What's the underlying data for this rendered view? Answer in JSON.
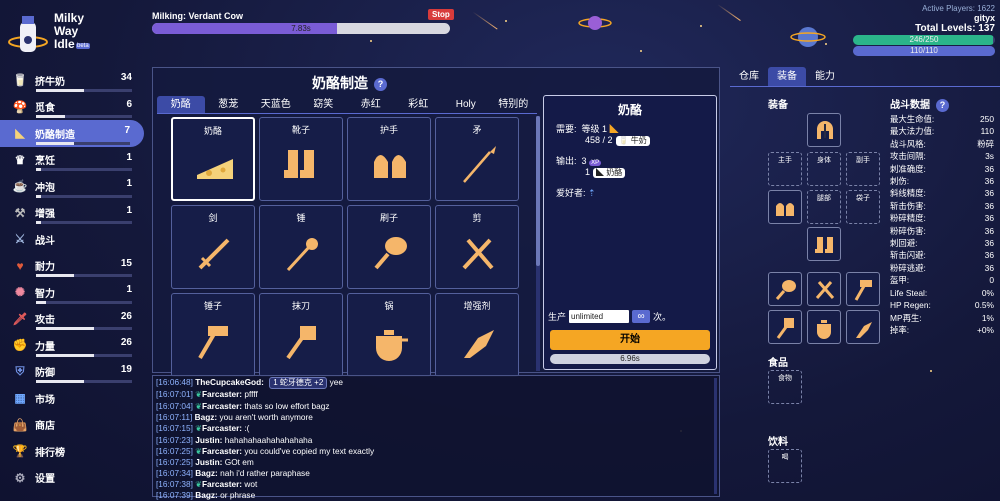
{
  "header": {
    "title_lines": [
      "Milky",
      "Way",
      "Idle"
    ],
    "beta": "beta",
    "action": "Milking: Verdant Cow",
    "stop": "Stop",
    "progress_time": "7.83s",
    "progress": 0.62,
    "active_players": "Active Players: 1622",
    "username": "gityx",
    "total_levels": "Total Levels: 137",
    "hp": "246/250",
    "hp_frac": 0.984,
    "mp": "110/110",
    "mp_frac": 1.0
  },
  "sidebar": [
    {
      "label": "挤牛奶",
      "level": "34",
      "bar": 0.5,
      "icon": "milk-icon"
    },
    {
      "label": "觅食",
      "level": "6",
      "bar": 0.3,
      "icon": "mushroom-icon"
    },
    {
      "label": "奶酪制造",
      "level": "7",
      "bar": 0.4,
      "icon": "cheese-icon",
      "active": true
    },
    {
      "label": "烹饪",
      "level": "1",
      "bar": 0.05,
      "icon": "chef-hat-icon"
    },
    {
      "label": "冲泡",
      "level": "1",
      "bar": 0.05,
      "icon": "teacup-icon"
    },
    {
      "label": "增强",
      "level": "1",
      "bar": 0.05,
      "icon": "enhance-icon"
    },
    {
      "label": "战斗",
      "level": "",
      "icon": "swords-icon"
    },
    {
      "label": "耐力",
      "level": "15",
      "bar": 0.4,
      "icon": "stamina-icon"
    },
    {
      "label": "智力",
      "level": "1",
      "bar": 0.1,
      "icon": "brain-icon"
    },
    {
      "label": "攻击",
      "level": "26",
      "bar": 0.6,
      "icon": "sword-icon"
    },
    {
      "label": "力量",
      "level": "26",
      "bar": 0.6,
      "icon": "fist-icon"
    },
    {
      "label": "防御",
      "level": "19",
      "bar": 0.5,
      "icon": "shield-icon"
    },
    {
      "label": "市场",
      "level": "",
      "icon": "market-icon"
    },
    {
      "label": "商店",
      "level": "",
      "icon": "shop-icon"
    },
    {
      "label": "排行榜",
      "level": "",
      "icon": "trophy-icon"
    },
    {
      "label": "设置",
      "level": "",
      "icon": "gear-icon"
    }
  ],
  "panel": {
    "title": "奶酪制造",
    "help": "?",
    "tabs": [
      "奶酪",
      "葱茏",
      "天蓝色",
      "窈笑",
      "赤红",
      "彩虹",
      "Holy",
      "特别的"
    ],
    "items": [
      {
        "name": "奶酪",
        "icon": "cheese-icon"
      },
      {
        "name": "靴子",
        "icon": "boots-icon"
      },
      {
        "name": "护手",
        "icon": "gloves-icon"
      },
      {
        "name": "矛",
        "icon": "spear-icon"
      },
      {
        "name": "剑",
        "icon": "sword-icon"
      },
      {
        "name": "锤",
        "icon": "mace-icon"
      },
      {
        "name": "刷子",
        "icon": "brush-icon"
      },
      {
        "name": "剪",
        "icon": "shears-icon"
      },
      {
        "name": "锤子",
        "icon": "hammer-icon"
      },
      {
        "name": "抹刀",
        "icon": "spatula-icon"
      },
      {
        "name": "锅",
        "icon": "pot-icon"
      },
      {
        "name": "增强剂",
        "icon": "enhancer-icon"
      }
    ]
  },
  "detail": {
    "title": "奶酪",
    "req_label": "需要:",
    "req_level": "等级 1",
    "req_count": "458 / 2",
    "req_item": "牛奶",
    "out_label": "输出:",
    "xp": "3",
    "xp_badge": "XP",
    "out_count": "1",
    "out_item": "奶酪",
    "fans": "爱好者:",
    "produce": "生产",
    "qty": "unlimited",
    "inf": "∞",
    "times": "次。",
    "start": "开始",
    "time": "6.96s"
  },
  "chat": [
    {
      "t": "[16:06:48]",
      "u": "TheCupcakeGod:",
      "x": "",
      "chip": "1 蛇牙德克 +2",
      "m": " yee"
    },
    {
      "t": "[16:07:01]",
      "u": "Farcaster:",
      "x": "leaf",
      "m": " pffff"
    },
    {
      "t": "[16:07:04]",
      "u": "Farcaster:",
      "x": "leaf",
      "m": " thats so low effort bagz"
    },
    {
      "t": "[16:07:11]",
      "u": "Bagz:",
      "x": "",
      "m": " you aren't worth anymore"
    },
    {
      "t": "[16:07:15]",
      "u": "Farcaster:",
      "x": "leaf",
      "m": " :("
    },
    {
      "t": "[16:07:23]",
      "u": "Justin:",
      "x": "",
      "m": " hahahahaahahahahaha"
    },
    {
      "t": "[16:07:25]",
      "u": "Farcaster:",
      "x": "leaf",
      "m": " you could've copied my text exactly"
    },
    {
      "t": "[16:07:25]",
      "u": "Justin:",
      "x": "",
      "m": " GOt em"
    },
    {
      "t": "[16:07:34]",
      "u": "Bagz:",
      "x": "",
      "m": " nah i'd rather paraphase"
    },
    {
      "t": "[16:07:38]",
      "u": "Farcaster:",
      "x": "leaf",
      "m": " wot"
    },
    {
      "t": "[16:07:39]",
      "u": "Bagz:",
      "x": "",
      "m": " or phrase"
    }
  ],
  "right": {
    "tabs": [
      "仓库",
      "装备",
      "能力"
    ],
    "equip_title": "装备",
    "stats_title": "战斗数据",
    "help": "?",
    "slots": {
      "main": "主手",
      "body": "身体",
      "off": "副手",
      "legs": "腿部",
      "pouch": "袋子"
    },
    "food": "食品",
    "food_slot": "食物",
    "drink": "饮料",
    "drink_slot": "喝",
    "stats": [
      [
        "最大生命值:",
        "250"
      ],
      [
        "最大法力值:",
        "110"
      ],
      [
        "战斗风格:",
        "粉碎"
      ],
      [
        "攻击间隔:",
        "3s"
      ],
      [
        "刺准确度:",
        "36"
      ],
      [
        "刺伤:",
        "36"
      ],
      [
        "斜线精度:",
        "36"
      ],
      [
        "斩击伤害:",
        "36"
      ],
      [
        "粉碎精度:",
        "36"
      ],
      [
        "粉碎伤害:",
        "36"
      ],
      [
        "刺回避:",
        "36"
      ],
      [
        "斩击闪避:",
        "36"
      ],
      [
        "粉碎逃避:",
        "36"
      ],
      [
        "盔甲:",
        "0"
      ],
      [
        "Life Steal:",
        "0%"
      ],
      [
        "HP Regen:",
        "0.5%"
      ],
      [
        "MP再生:",
        "1%"
      ],
      [
        "掉率:",
        "+0%"
      ]
    ]
  }
}
